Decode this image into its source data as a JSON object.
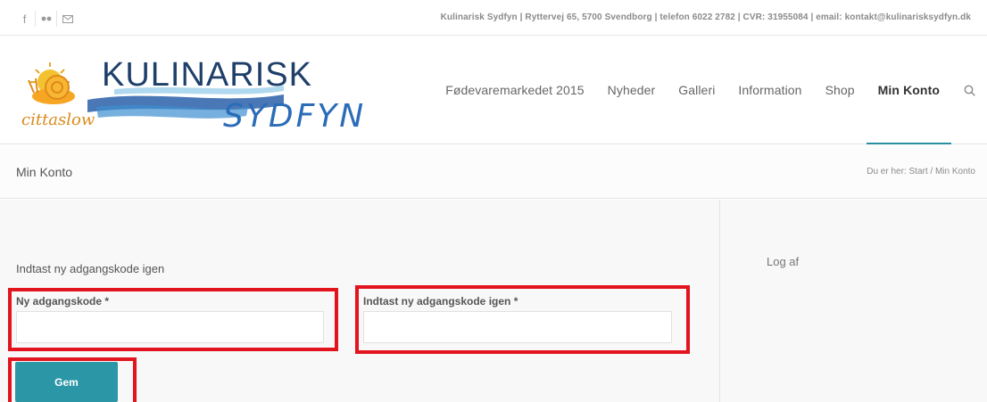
{
  "topbar": {
    "social_icons": [
      "facebook-icon",
      "flickr-icon",
      "mail-icon"
    ],
    "contact_text": "Kulinarisk Sydfyn | Ryttervej 65, 5700 Svendborg | telefon 6022 2782 | CVR: 31955084 | email: kontakt@kulinarisksydfyn.dk"
  },
  "logo": {
    "word1": "KULINARISK",
    "word2": "SYDFYN",
    "tagline": "cittaslow"
  },
  "nav": {
    "items": [
      "Fødevaremarkedet 2015",
      "Nyheder",
      "Galleri",
      "Information",
      "Shop",
      "Min Konto"
    ],
    "active": "Min Konto",
    "search_icon": "search-icon"
  },
  "titlebar": {
    "title": "Min Konto",
    "breadcrumb_prefix": "Du er her:",
    "breadcrumb_home": "Start",
    "breadcrumb_sep": "/",
    "breadcrumb_current": "Min Konto"
  },
  "form": {
    "heading": "Indtast ny adgangskode igen",
    "password_label": "Ny adgangskode",
    "password_value": "",
    "confirm_label": "Indtast ny adgangskode igen",
    "confirm_value": "",
    "required_mark": "*",
    "submit_label": "Gem"
  },
  "sidebar": {
    "logout_label": "Log af"
  },
  "colors": {
    "accent": "#2b96a6",
    "highlight": "#e2141d",
    "background": "#f8f8f8"
  }
}
